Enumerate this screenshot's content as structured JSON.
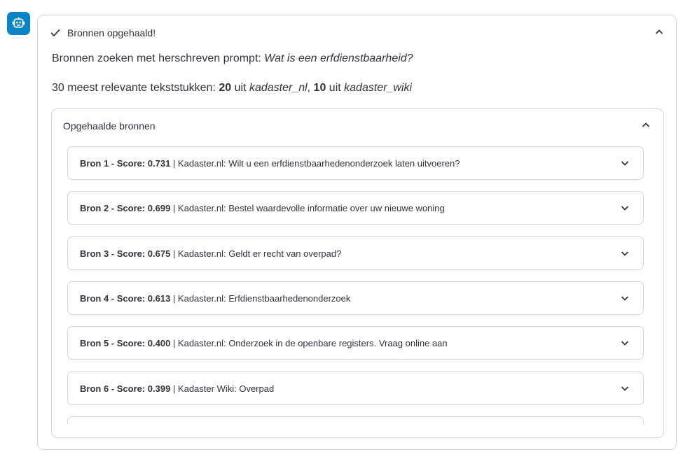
{
  "assistant": {
    "avatar_icon": "robot-icon",
    "avatar_color": "#0a84c9"
  },
  "status": {
    "icon": "checkmark-icon",
    "text": "Bronnen opgehaald!"
  },
  "prompt_line": {
    "prefix": "Bronnen zoeken met herschreven prompt: ",
    "query": "Wat is een erfdienstbaarheid?"
  },
  "relevance_line": {
    "prefix": "30 meest relevante tekststukken: ",
    "count1": "20",
    "mid1": " uit ",
    "source1": "kadaster_nl",
    "sep": ", ",
    "count2": "10",
    "mid2": " uit ",
    "source2": "kadaster_wiki"
  },
  "sources_panel": {
    "title": "Opgehaalde bronnen",
    "items": [
      {
        "label": "Bron 1 - Score: 0.731",
        "title": " | Kadaster.nl: Wilt u een erfdienstbaarhedenonderzoek laten uitvoeren?"
      },
      {
        "label": "Bron 2 - Score: 0.699",
        "title": " | Kadaster.nl: Bestel waardevolle informatie over uw nieuwe woning"
      },
      {
        "label": "Bron 3 - Score: 0.675",
        "title": " | Kadaster.nl: Geldt er recht van overpad?"
      },
      {
        "label": "Bron 4 - Score: 0.613",
        "title": " | Kadaster.nl: Erfdienstbaarhedenonderzoek"
      },
      {
        "label": "Bron 5 - Score: 0.400",
        "title": " | Kadaster.nl: Onderzoek in de openbare registers. Vraag online aan"
      },
      {
        "label": "Bron 6 - Score: 0.399",
        "title": " | Kadaster Wiki: Overpad"
      },
      {
        "label": "",
        "title": ""
      }
    ]
  }
}
